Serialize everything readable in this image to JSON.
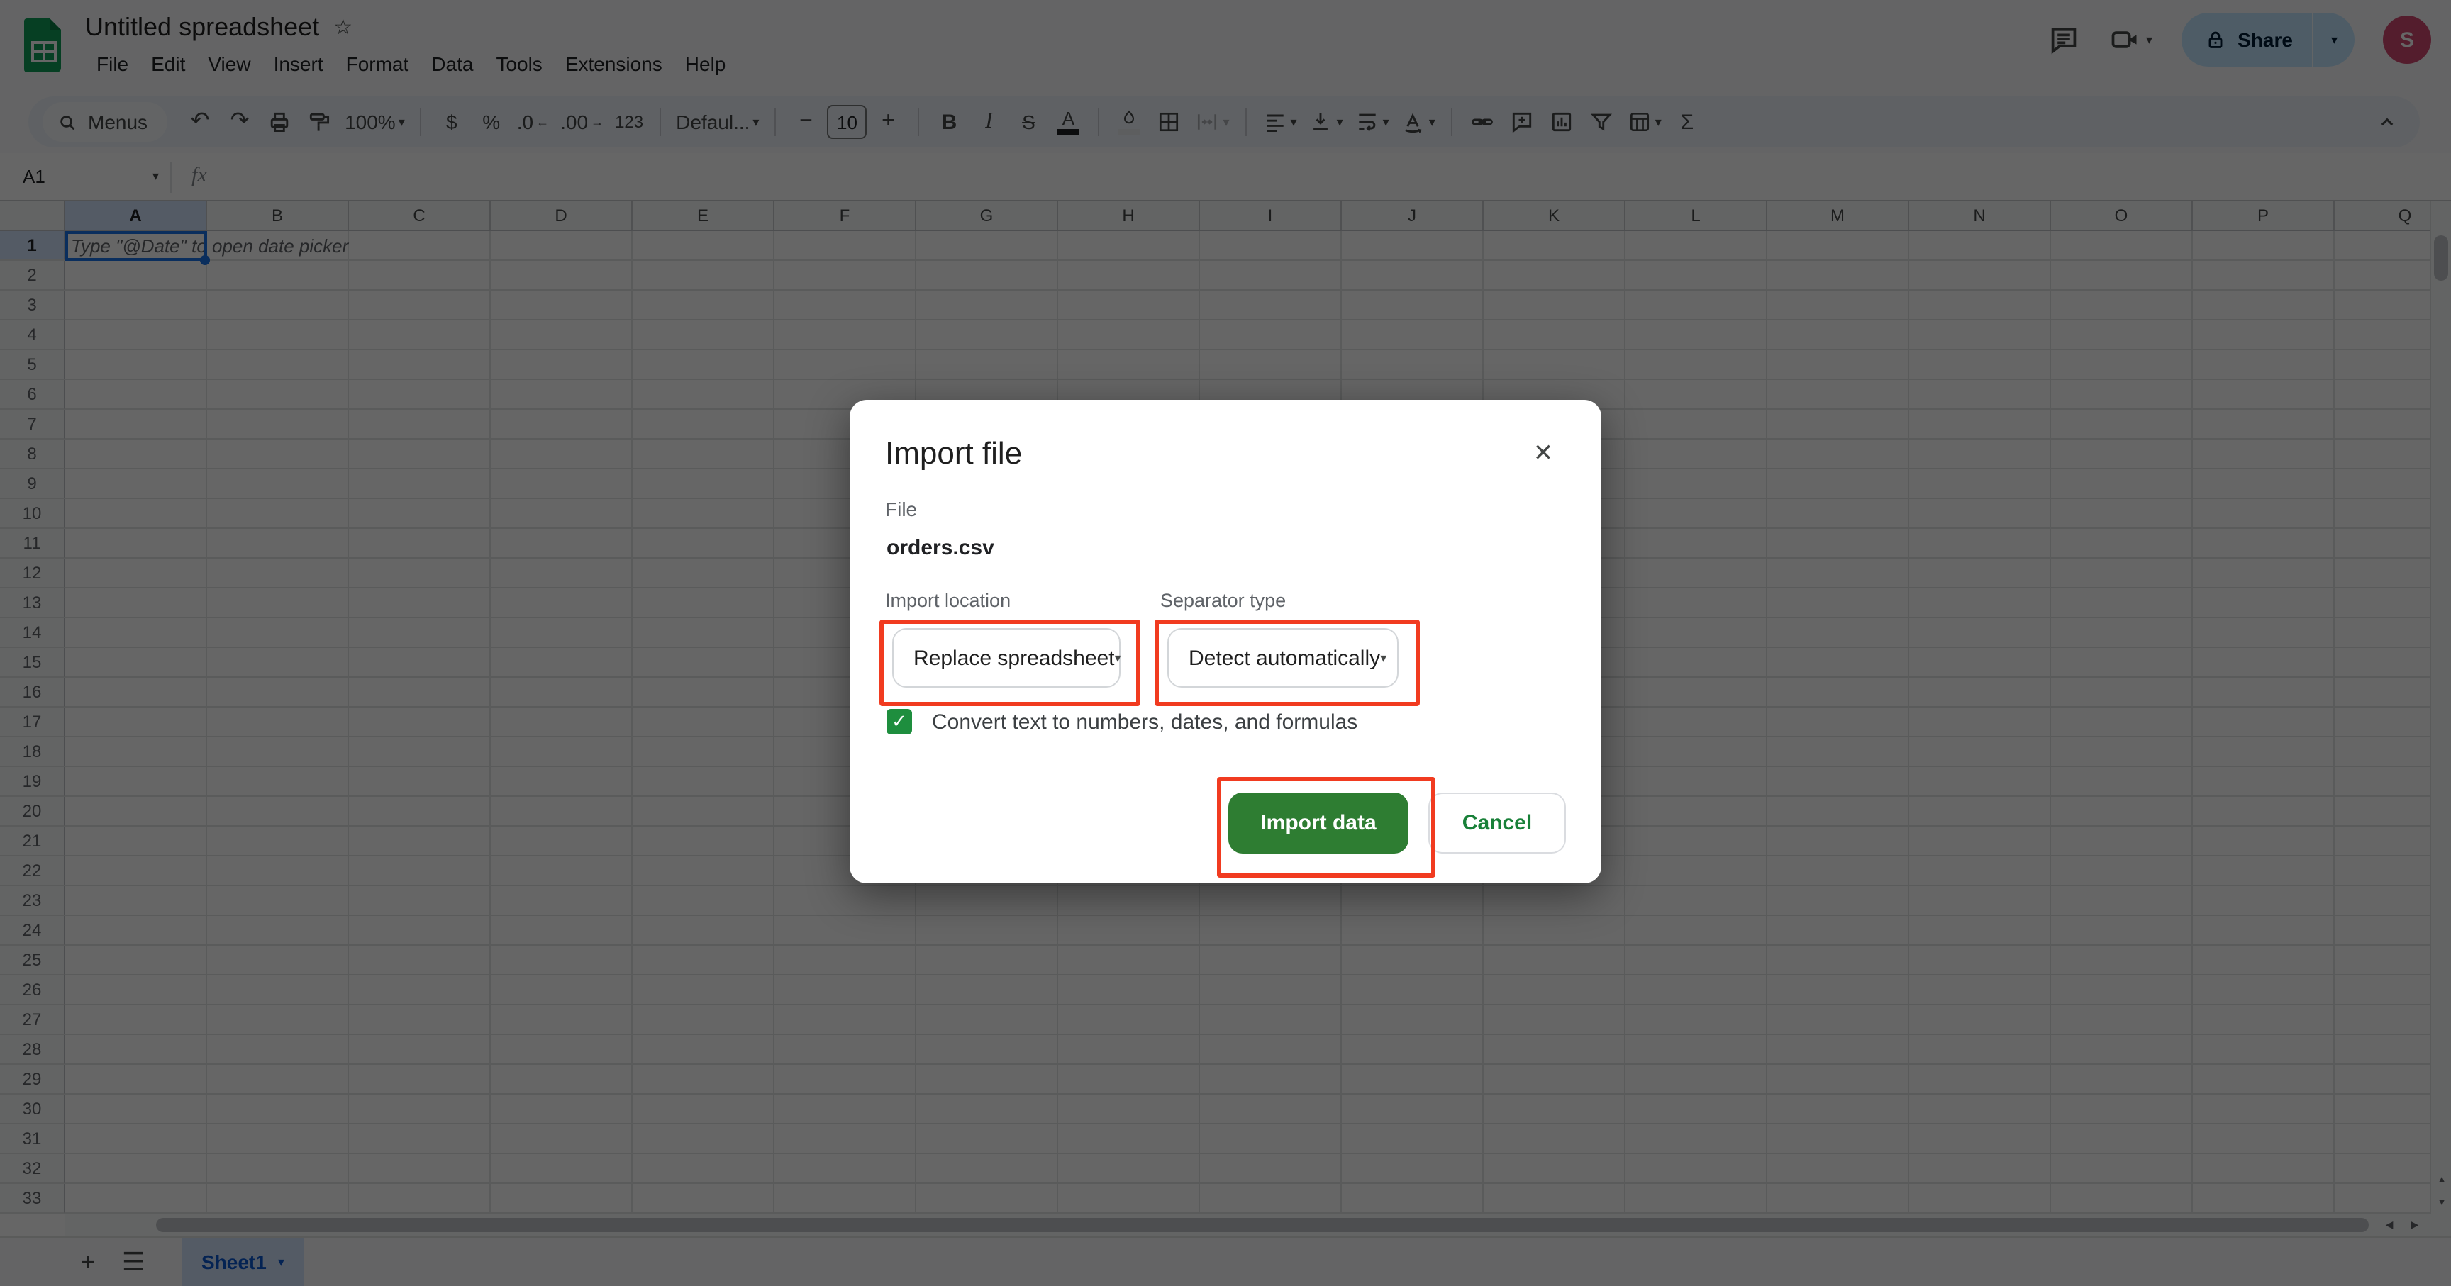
{
  "app": {
    "product": "Google Sheets",
    "title": "Untitled spreadsheet"
  },
  "menubar": {
    "items": [
      "File",
      "Edit",
      "View",
      "Insert",
      "Format",
      "Data",
      "Tools",
      "Extensions",
      "Help"
    ]
  },
  "topbar": {
    "share_label": "Share",
    "avatar_initial": "S"
  },
  "toolbar": {
    "menus_label": "Menus",
    "zoom_value": "100%",
    "currency": "$",
    "percent": "%",
    "decrease_decimal": ".0",
    "increase_decimal": ".00",
    "number_format": "123",
    "font_name": "Defaul...",
    "font_size": "10",
    "bold_glyph": "B",
    "italic_glyph": "I",
    "strikethrough_glyph": "S",
    "text_color_glyph": "A",
    "functions_glyph": "Σ"
  },
  "formula_bar": {
    "cell_ref": "A1",
    "fx": "fx"
  },
  "grid": {
    "columns": [
      "A",
      "B",
      "C",
      "D",
      "E",
      "F",
      "G",
      "H",
      "I",
      "J",
      "K",
      "L",
      "M",
      "N",
      "O",
      "P",
      "Q"
    ],
    "row_count": 33,
    "selected_column": "A",
    "selected_row": 1,
    "selected_cell": "A1",
    "placeholder_text": "Type \"@Date\" to open date picker"
  },
  "sheet_tabs": {
    "active": "Sheet1"
  },
  "dialog": {
    "title": "Import file",
    "file_label": "File",
    "file_name": "orders.csv",
    "import_location_label": "Import location",
    "import_location_value": "Replace spreadsheet",
    "separator_label": "Separator type",
    "separator_value": "Detect automatically",
    "checkbox_checked": true,
    "checkbox_label": "Convert text to numbers, dates, and formulas",
    "primary_label": "Import data",
    "cancel_label": "Cancel"
  },
  "colors": {
    "chrome_bg": "#f9fbfd",
    "toolbar_pill_bg": "#edf2fa",
    "icon_gray": "#444746",
    "brand_green": "#0f9d58",
    "primary_button_green": "#2e7d32",
    "cancel_text_green": "#188038",
    "checkbox_green": "#1e8e3e",
    "annotation_red": "#f13b20",
    "selection_blue": "#1a73e8",
    "header_selected_blue": "#d3e3fd",
    "active_tab_text": "#0b57d0",
    "share_pill_bg": "#c2e7ff",
    "share_pill_text": "#001d35",
    "avatar_bg": "#d24a72",
    "scrim": "rgba(0,0,0,0.6)"
  }
}
